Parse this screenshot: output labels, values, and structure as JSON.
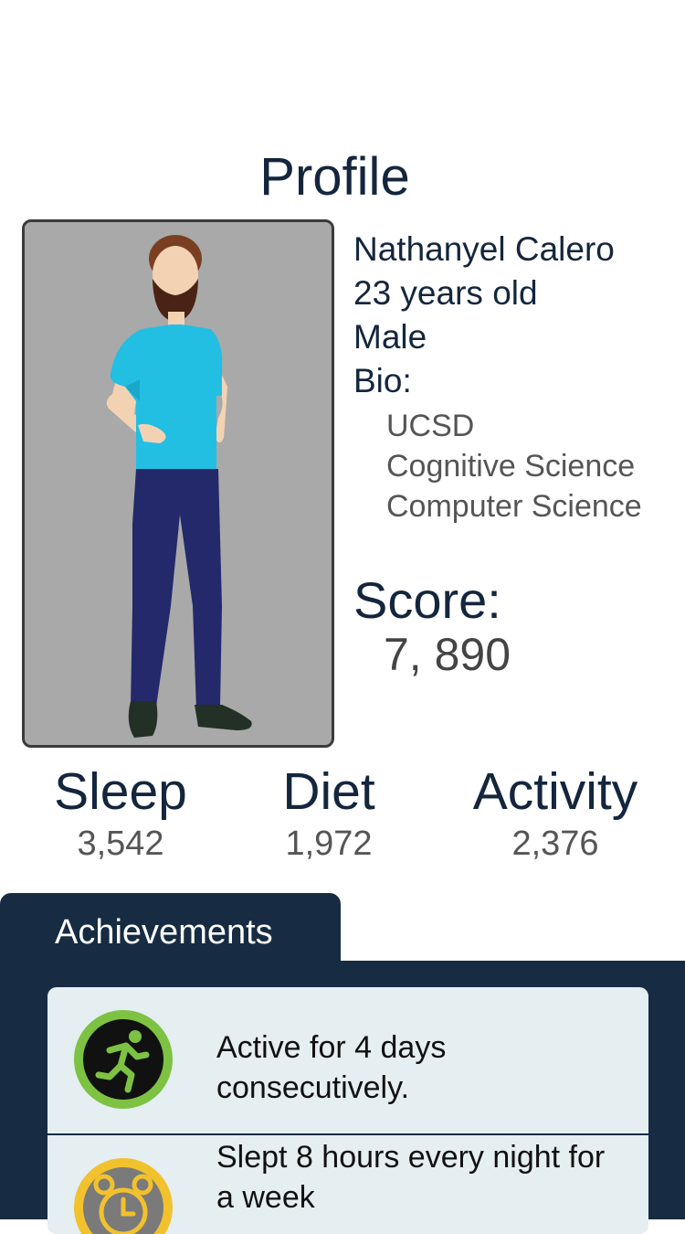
{
  "header": {
    "title": "Profile"
  },
  "profile": {
    "name": "Nathanyel Calero",
    "age": "23 years old",
    "gender": "Male",
    "bio_label": "Bio:",
    "bio_lines": [
      "UCSD",
      "Cognitive Science",
      "Computer Science"
    ]
  },
  "score": {
    "label": "Score:",
    "value": "7, 890"
  },
  "stats": [
    {
      "label": "Sleep",
      "value": "3,542"
    },
    {
      "label": "Diet",
      "value": "1,972"
    },
    {
      "label": "Activity",
      "value": "2,376"
    }
  ],
  "achievements": {
    "tab_label": "Achievements",
    "items": [
      {
        "text": "Active for 4 days consecutively.",
        "icon": "running-icon",
        "ring_color": "#7dc242"
      },
      {
        "text": "Slept 8 hours every night for a week",
        "icon": "alarm-clock-icon",
        "ring_color": "#f2c12e"
      }
    ]
  },
  "colors": {
    "navy": "#172c42",
    "card_bg": "#e5eef1",
    "avatar_bg": "#a9a9a9",
    "shirt": "#22bfe3",
    "pants": "#23296a"
  }
}
